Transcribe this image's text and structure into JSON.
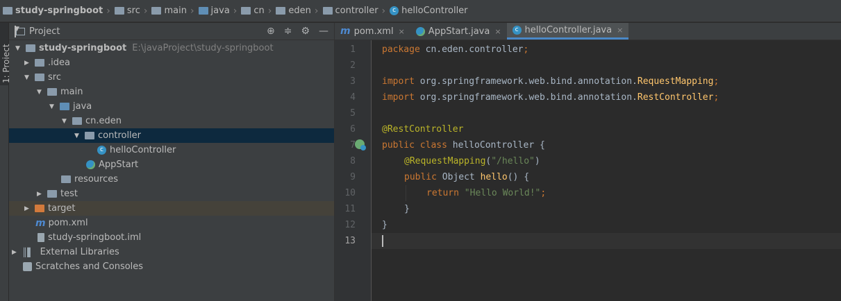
{
  "breadcrumb": {
    "items": [
      {
        "label": "study-springboot",
        "icon": "module-icon",
        "bold": true
      },
      {
        "label": "src",
        "icon": "folder-icon"
      },
      {
        "label": "main",
        "icon": "folder-icon"
      },
      {
        "label": "java",
        "icon": "source-folder-icon"
      },
      {
        "label": "cn",
        "icon": "folder-icon"
      },
      {
        "label": "eden",
        "icon": "folder-icon"
      },
      {
        "label": "controller",
        "icon": "folder-icon"
      },
      {
        "label": "helloController",
        "icon": "class-icon"
      }
    ]
  },
  "side_stripe": {
    "label": "1: Project"
  },
  "project_panel": {
    "title": "Project",
    "tools": [
      "crosshair-icon",
      "collapse-icon",
      "gear-icon",
      "minimize-icon"
    ],
    "tree": [
      {
        "label": "study-springboot",
        "hint": "E:\\javaProject\\study-springboot",
        "bold": true
      },
      {
        "label": ".idea"
      },
      {
        "label": "src"
      },
      {
        "label": "main"
      },
      {
        "label": "java"
      },
      {
        "label": "cn.eden"
      },
      {
        "label": "controller"
      },
      {
        "label": "helloController"
      },
      {
        "label": "AppStart"
      },
      {
        "label": "resources"
      },
      {
        "label": "test"
      },
      {
        "label": "target"
      },
      {
        "label": "pom.xml"
      },
      {
        "label": "study-springboot.iml"
      },
      {
        "label": "External Libraries"
      },
      {
        "label": "Scratches and Consoles"
      }
    ]
  },
  "editor": {
    "tabs": [
      {
        "label": "pom.xml",
        "icon": "maven-icon",
        "close": "×"
      },
      {
        "label": "AppStart.java",
        "icon": "spring-class-icon",
        "close": "×"
      },
      {
        "label": "helloController.java",
        "icon": "class-icon",
        "close": "×",
        "active": true
      }
    ],
    "line_numbers": [
      "1",
      "2",
      "3",
      "4",
      "5",
      "6",
      "7",
      "8",
      "9",
      "10",
      "11",
      "12",
      "13"
    ],
    "current_line": 13,
    "code": {
      "l1_kw": "package",
      "l1_rest": " cn.eden.controller",
      "l3_kw": "import",
      "l3_rest": " org.springframework.web.bind.annotation.",
      "l3_cls": "RequestMapping",
      "l4_kw": "import",
      "l4_rest": " org.springframework.web.bind.annotation.",
      "l4_cls": "RestController",
      "l6_an": "@RestController",
      "l7_kw": "public class",
      "l7_rest": " helloController {",
      "l8_an": "@RequestMapping",
      "l8_p1": "(",
      "l8_str": "\"/hello\"",
      "l8_p2": ")",
      "l9_kw": "public",
      "l9_rest1": " Object ",
      "l9_fn": "hello",
      "l9_rest2": "() {",
      "l10_kw": "return",
      "l10_str": "\"Hello World!\"",
      "l11": "}",
      "l12": "}"
    }
  }
}
